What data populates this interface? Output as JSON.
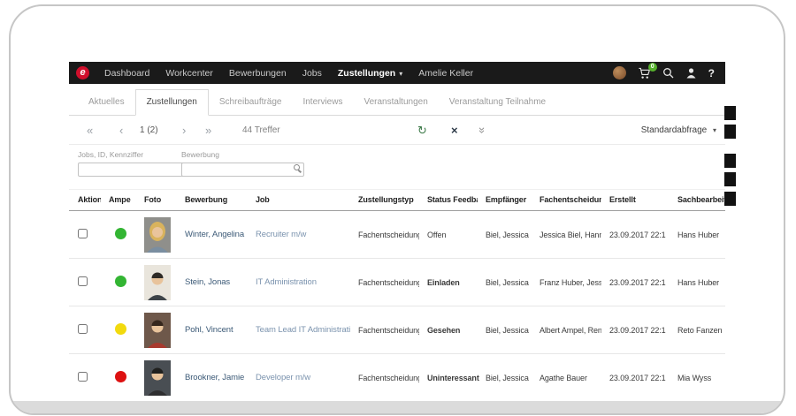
{
  "topbar": {
    "brand_letter": "e",
    "menu": [
      {
        "label": "Dashboard"
      },
      {
        "label": "Workcenter"
      },
      {
        "label": "Bewerbungen"
      },
      {
        "label": "Jobs"
      },
      {
        "label": "Zustellungen"
      }
    ],
    "user": "Amelie Keller",
    "cart_badge": "0",
    "help_label": "?"
  },
  "icons": {
    "caret_down": "▾",
    "first": "«",
    "prev": "‹",
    "next": "›",
    "last": "»",
    "refresh": "↻",
    "clear": "×",
    "collapse": "»"
  },
  "tabs": [
    {
      "label": "Aktuelles"
    },
    {
      "label": "Zustellungen"
    },
    {
      "label": "Schreibaufträge"
    },
    {
      "label": "Interviews"
    },
    {
      "label": "Veranstaltungen"
    },
    {
      "label": "Veranstaltung Teilnahme"
    }
  ],
  "active_tab": "Zustellungen",
  "pagination": {
    "page": "1 (2)",
    "results": "44 Treffer",
    "preset": "Standardabfrage"
  },
  "filters": [
    {
      "label": "Jobs, ID, Kennziffer",
      "value": ""
    },
    {
      "label": "Bewerbung",
      "value": ""
    }
  ],
  "table": {
    "headers": [
      "Aktion",
      "Ampe",
      "Foto",
      "Bewerbung",
      "Job",
      "Zustellungstyp",
      "Status Feedba",
      "Empfänger",
      "Fachentscheidung",
      "Erstellt",
      "Sachbearbeiter"
    ],
    "rows": [
      {
        "ampel": "green",
        "name": "Winter, Angelina",
        "job": "Recruiter m/w",
        "typ": "Fachentscheidung",
        "status": "Offen",
        "empfaenger": "Biel, Jessica",
        "fachentscheidung": "Jessica Biel, Hanne I",
        "erstellt": "23.09.2017 22:1",
        "sachbearbeiter": "Hans Huber"
      },
      {
        "ampel": "green",
        "name": "Stein, Jonas",
        "job": "IT Administration",
        "typ": "Fachentscheidung",
        "status": "Einladen",
        "empfaenger": "Biel, Jessica",
        "fachentscheidung": "Franz Huber, Jessica",
        "erstellt": "23.09.2017 22:1",
        "sachbearbeiter": "Hans Huber"
      },
      {
        "ampel": "yellow",
        "name": "Pohl, Vincent",
        "job": "Team Lead IT Administration",
        "typ": "Fachentscheidung",
        "status": "Gesehen",
        "empfaenger": "Biel, Jessica",
        "fachentscheidung": "Albert Ampel, Rena",
        "erstellt": "23.09.2017 22:1",
        "sachbearbeiter": "Reto Fanzen"
      },
      {
        "ampel": "red",
        "name": "Brookner, Jamie",
        "job": "Developer m/w",
        "typ": "Fachentscheidung",
        "status": "Uninteressant",
        "empfaenger": "Biel, Jessica",
        "fachentscheidung": "Agathe Bauer",
        "erstellt": "23.09.2017 22:1",
        "sachbearbeiter": "Mia Wyss"
      }
    ]
  },
  "colors": {
    "brand_red": "#d00f2c",
    "badge_green": "#56b12c",
    "ampel_green": "#33b533",
    "ampel_yellow": "#f2da0e",
    "ampel_red": "#dd1111",
    "link_blue": "#7b93ae",
    "name_blue": "#3c5a77",
    "topbar_bg": "#1a1a1a"
  }
}
